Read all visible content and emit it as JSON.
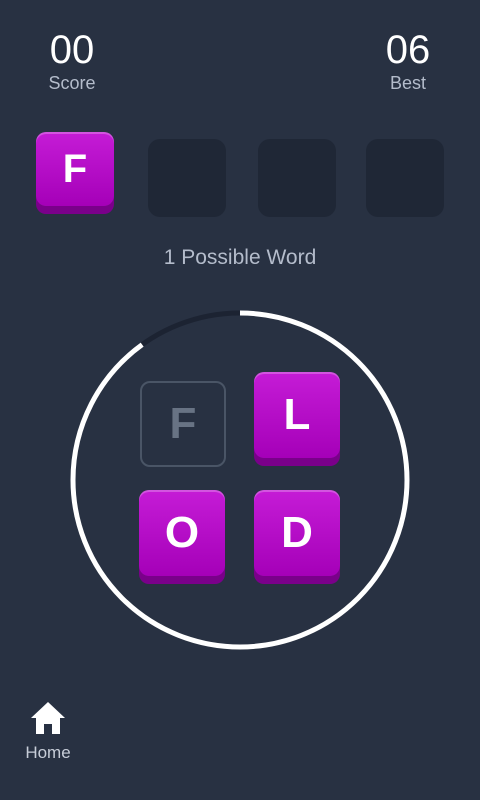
{
  "score": {
    "value": "00",
    "label": "Score"
  },
  "best": {
    "value": "06",
    "label": "Best"
  },
  "answer_slots": [
    "F",
    "",
    "",
    ""
  ],
  "possible_words": "1 Possible Word",
  "wheel_letters": [
    {
      "letter": "F",
      "used": true
    },
    {
      "letter": "L",
      "used": false
    },
    {
      "letter": "O",
      "used": false
    },
    {
      "letter": "D",
      "used": false
    }
  ],
  "timer_remaining_fraction": 0.9,
  "colors": {
    "background": "#283142",
    "tile": "#b80fca",
    "slot": "#1f2736",
    "ring": "#ffffff"
  },
  "home": {
    "icon": "home-icon",
    "label": "Home"
  }
}
